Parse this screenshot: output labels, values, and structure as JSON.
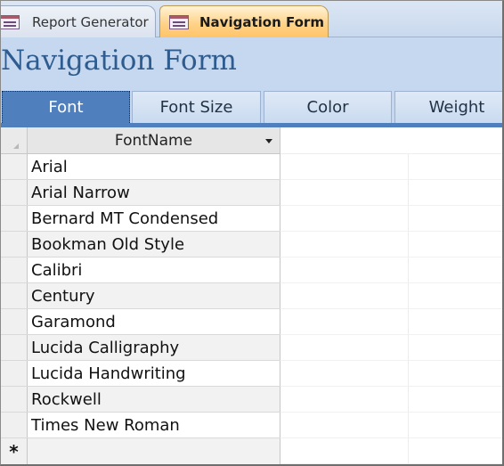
{
  "tabs": [
    {
      "label": "Report Generator",
      "active": false,
      "icon": "form-icon"
    },
    {
      "label": "Navigation Form",
      "active": true,
      "icon": "form-icon"
    }
  ],
  "header": {
    "title": "Navigation Form"
  },
  "nav": {
    "buttons": [
      "Font",
      "Font Size",
      "Color",
      "Weight"
    ],
    "active": "Font"
  },
  "grid": {
    "column_header": "FontName",
    "rows": [
      "Arial",
      "Arial Narrow",
      "Bernard MT Condensed",
      "Bookman Old Style",
      "Calibri",
      "Century",
      "Garamond",
      "Lucida Calligraphy",
      "Lucida Handwriting",
      "Rockwell",
      "Times New Roman"
    ],
    "new_row_marker": "*"
  },
  "colors": {
    "accent": "#4f7fbd",
    "header_bg": "#c5d8f0",
    "title": "#2f5c8f",
    "active_tab": "#ffc467"
  }
}
